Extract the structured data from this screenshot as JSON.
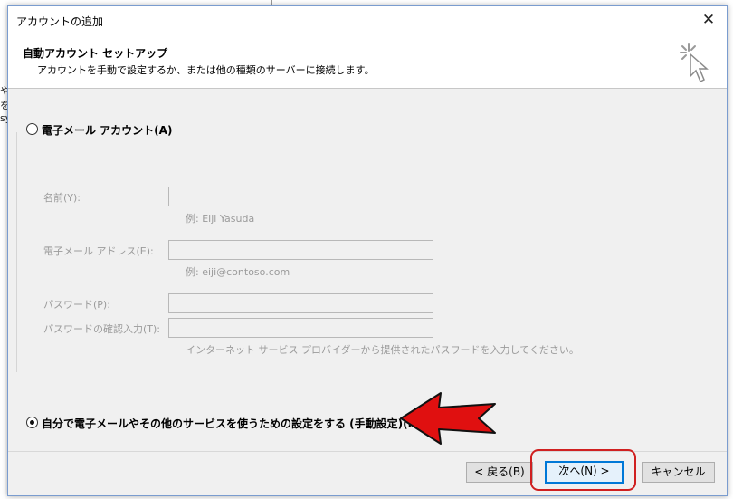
{
  "window": {
    "title": "アカウントの追加",
    "close_glyph": "✕"
  },
  "header": {
    "title": "自動アカウント セットアップ",
    "subtitle": "アカウントを手動で設定するか、または他の種類のサーバーに接続します。"
  },
  "options": {
    "email_account": {
      "label": "電子メール アカウント(A)",
      "selected": false
    },
    "manual_setup": {
      "label": "自分で電子メールやその他のサービスを使うための設定をする (手動設定)(M)",
      "selected": true
    }
  },
  "form": {
    "name": {
      "label": "名前(Y):",
      "value": "",
      "hint": "例: Eiji Yasuda"
    },
    "email": {
      "label": "電子メール アドレス(E):",
      "value": "",
      "hint": "例: eiji@contoso.com"
    },
    "password": {
      "label": "パスワード(P):",
      "value": ""
    },
    "password_confirm": {
      "label": "パスワードの確認入力(T):",
      "value": ""
    },
    "password_hint": "インターネット サービス プロバイダーから提供されたパスワードを入力してください。"
  },
  "buttons": {
    "back": "< 戻る(B)",
    "next": "次へ(N) >",
    "cancel": "キャンセル"
  },
  "annotations": {
    "arrow_color": "#e01010",
    "ring_color": "#d02020"
  },
  "background_app": {
    "glyphs": [
      "や",
      "を",
      "sy"
    ]
  }
}
